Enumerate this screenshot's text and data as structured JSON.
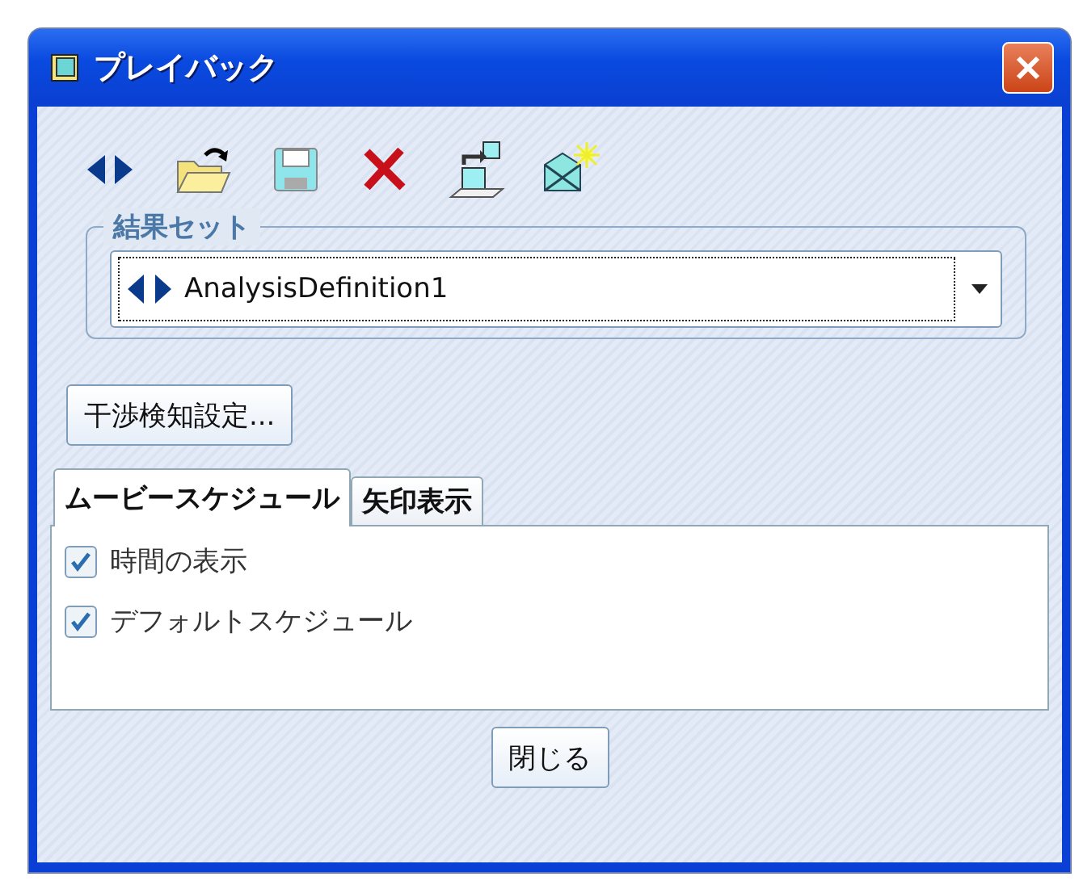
{
  "window": {
    "title": "プレイバック"
  },
  "toolbar": [
    {
      "kind": "arrows"
    },
    {
      "kind": "open"
    },
    {
      "kind": "save"
    },
    {
      "kind": "delete"
    },
    {
      "kind": "export"
    },
    {
      "kind": "envelope"
    }
  ],
  "result_set": {
    "label": "結果セット",
    "value": "AnalysisDefinition1"
  },
  "interference_button": "干渉検知設定...",
  "tabs": [
    {
      "label": "ムービースケジュール",
      "selected": true
    },
    {
      "label": "矢印表示",
      "selected": false
    }
  ],
  "options": [
    {
      "label": "時間の表示",
      "checked": true
    },
    {
      "label": "デフォルトスケジュール",
      "checked": true
    }
  ],
  "close_button": "閉じる"
}
